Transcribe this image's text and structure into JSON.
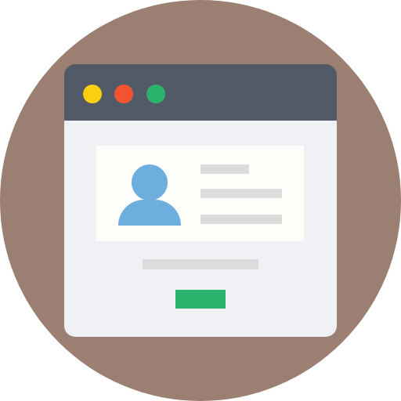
{
  "colors": {
    "background_circle": "#9a7f72",
    "title_bar": "#525967",
    "window_body": "#f0f1f5",
    "card": "#fdfdf9",
    "avatar": "#6eaedf",
    "placeholder_line": "#dcdcdc",
    "button": "#2bb36e",
    "dot_yellow": "#fccf12",
    "dot_red": "#f1542f",
    "dot_green": "#2bb36e"
  },
  "icons": {
    "avatar": "user-silhouette-icon"
  }
}
